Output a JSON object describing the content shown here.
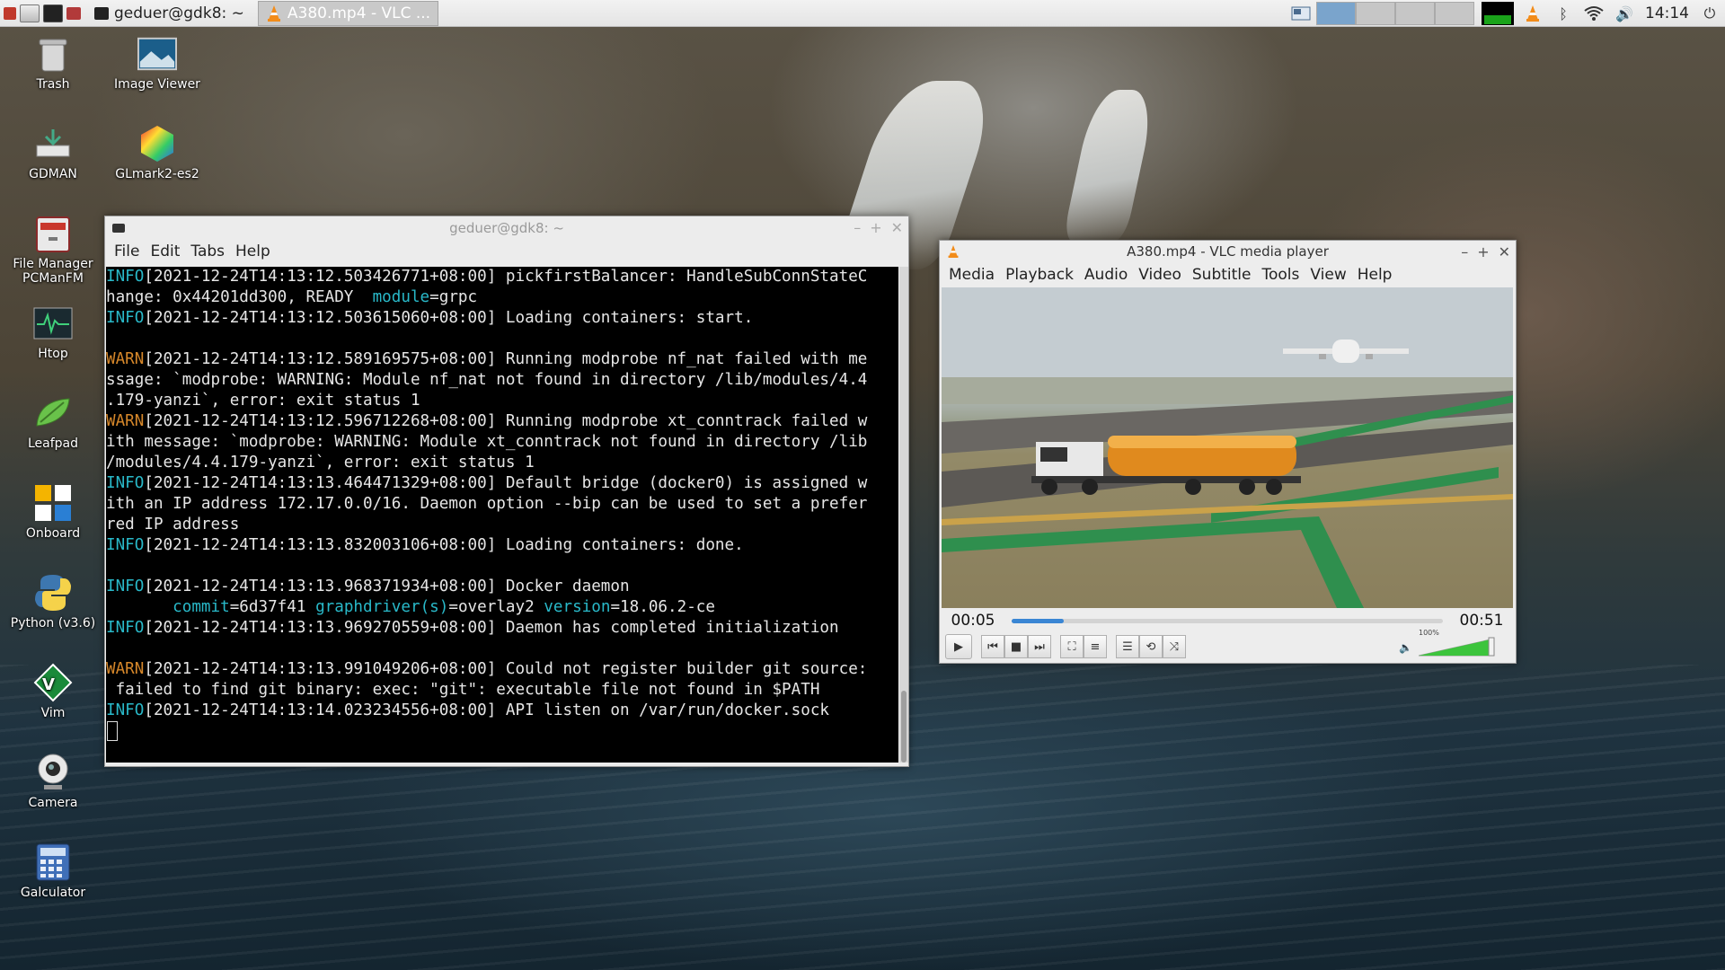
{
  "panel": {
    "tasks": [
      {
        "label": "geduer@gdk8: ~"
      },
      {
        "label": "A380.mp4 - VLC ..."
      }
    ],
    "clock": "14:14"
  },
  "desktop_icons": [
    {
      "label": "Trash",
      "icon": "trash-icon"
    },
    {
      "label": "Image Viewer",
      "icon": "image-viewer-icon"
    },
    {
      "label": "GDMAN",
      "icon": "gdman-icon"
    },
    {
      "label": "GLmark2-es2",
      "icon": "glmark-icon"
    },
    {
      "label": "File Manager PCManFM",
      "icon": "file-manager-icon"
    },
    {
      "label": "Htop",
      "icon": "htop-icon"
    },
    {
      "label": "Leafpad",
      "icon": "leafpad-icon"
    },
    {
      "label": "Onboard",
      "icon": "onboard-icon"
    },
    {
      "label": "Python (v3.6)",
      "icon": "python-icon"
    },
    {
      "label": "Vim",
      "icon": "vim-icon"
    },
    {
      "label": "Camera",
      "icon": "camera-icon"
    },
    {
      "label": "Galculator",
      "icon": "calculator-icon"
    }
  ],
  "terminal": {
    "title": "geduer@gdk8: ~",
    "menu": [
      "File",
      "Edit",
      "Tabs",
      "Help"
    ],
    "lines": [
      {
        "level": "INFO",
        "text": "[2021-12-24T14:13:12.503426771+08:00] pickfirstBalancer: HandleSubConnStateC"
      },
      {
        "level": "",
        "text": "hange: 0x44201dd300, READY  ",
        "key": "module",
        "val": "=grpc"
      },
      {
        "level": "INFO",
        "text": "[2021-12-24T14:13:12.503615060+08:00] Loading containers: start."
      },
      {
        "level": "",
        "text": ""
      },
      {
        "level": "WARN",
        "text": "[2021-12-24T14:13:12.589169575+08:00] Running modprobe nf_nat failed with me"
      },
      {
        "level": "",
        "text": "ssage: `modprobe: WARNING: Module nf_nat not found in directory /lib/modules/4.4"
      },
      {
        "level": "",
        "text": ".179-yanzi`, error: exit status 1"
      },
      {
        "level": "WARN",
        "text": "[2021-12-24T14:13:12.596712268+08:00] Running modprobe xt_conntrack failed w"
      },
      {
        "level": "",
        "text": "ith message: `modprobe: WARNING: Module xt_conntrack not found in directory /lib"
      },
      {
        "level": "",
        "text": "/modules/4.4.179-yanzi`, error: exit status 1"
      },
      {
        "level": "INFO",
        "text": "[2021-12-24T14:13:13.464471329+08:00] Default bridge (docker0) is assigned w"
      },
      {
        "level": "",
        "text": "ith an IP address 172.17.0.0/16. Daemon option --bip can be used to set a prefer"
      },
      {
        "level": "",
        "text": "red IP address"
      },
      {
        "level": "INFO",
        "text": "[2021-12-24T14:13:13.832003106+08:00] Loading containers: done."
      },
      {
        "level": "",
        "text": ""
      },
      {
        "level": "INFO",
        "text": "[2021-12-24T14:13:13.968371934+08:00] Docker daemon"
      },
      {
        "level": "",
        "text": "",
        "kv": [
          [
            "commit",
            "=6d37f41 "
          ],
          [
            "graphdriver(s)",
            "=overlay2 "
          ],
          [
            "version",
            "=18.06.2-ce"
          ]
        ]
      },
      {
        "level": "INFO",
        "text": "[2021-12-24T14:13:13.969270559+08:00] Daemon has completed initialization"
      },
      {
        "level": "",
        "text": ""
      },
      {
        "level": "WARN",
        "text": "[2021-12-24T14:13:13.991049206+08:00] Could not register builder git source:"
      },
      {
        "level": "",
        "text": " failed to find git binary: exec: \"git\": executable file not found in $PATH"
      },
      {
        "level": "INFO",
        "text": "[2021-12-24T14:13:14.023234556+08:00] API listen on /var/run/docker.sock"
      }
    ]
  },
  "vlc": {
    "title": "A380.mp4 - VLC media player",
    "menu": [
      "Media",
      "Playback",
      "Audio",
      "Video",
      "Subtitle",
      "Tools",
      "View",
      "Help"
    ],
    "elapsed": "00:05",
    "total": "00:51",
    "progress": 0.12,
    "volume_label": "100%",
    "volume": 1.0
  },
  "colors": {
    "info": "#29b9c9",
    "warn": "#d6872a",
    "vlc_progress": "#3a86d4",
    "vlc_volume": "#3cc43c"
  }
}
